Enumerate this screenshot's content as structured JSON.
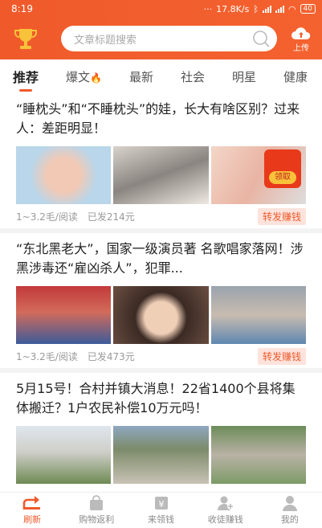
{
  "status": {
    "time": "8:19",
    "speed": "17.8K/s",
    "battery": "40"
  },
  "header": {
    "search_placeholder": "文章标题搜索",
    "upload_label": "上传"
  },
  "tabs": [
    {
      "label": "推荐"
    },
    {
      "label": "爆文"
    },
    {
      "label": "最新"
    },
    {
      "label": "社会"
    },
    {
      "label": "明星"
    },
    {
      "label": "健康"
    }
  ],
  "articles": [
    {
      "title": "“睡枕头”和“不睡枕头”的娃，长大有啥区别？过来人：差距明显！",
      "rate": "1~3.2毛/阅读",
      "earned": "已发214元",
      "share": "转发赚钱",
      "redpack": "领取"
    },
    {
      "title": "“东北黑老大”，国家一级演员著 名歌唱家落网！涉黑涉毒还“雇凶杀人”，犯罪...",
      "rate": "1~3.2毛/阅读",
      "earned": "已发473元",
      "share": "转发赚钱"
    },
    {
      "title": "5月15号！合村并镇大消息！22省1400个县将集体搬迁？1户农民补偿10万元吗！"
    }
  ],
  "bottom_nav": [
    {
      "label": "刷新"
    },
    {
      "label": "购物返利"
    },
    {
      "label": "来领钱"
    },
    {
      "label": "收徒赚钱"
    },
    {
      "label": "我的"
    }
  ],
  "colors": {
    "accent": "#f05a2b",
    "tag_bg": "#fde3dc"
  }
}
